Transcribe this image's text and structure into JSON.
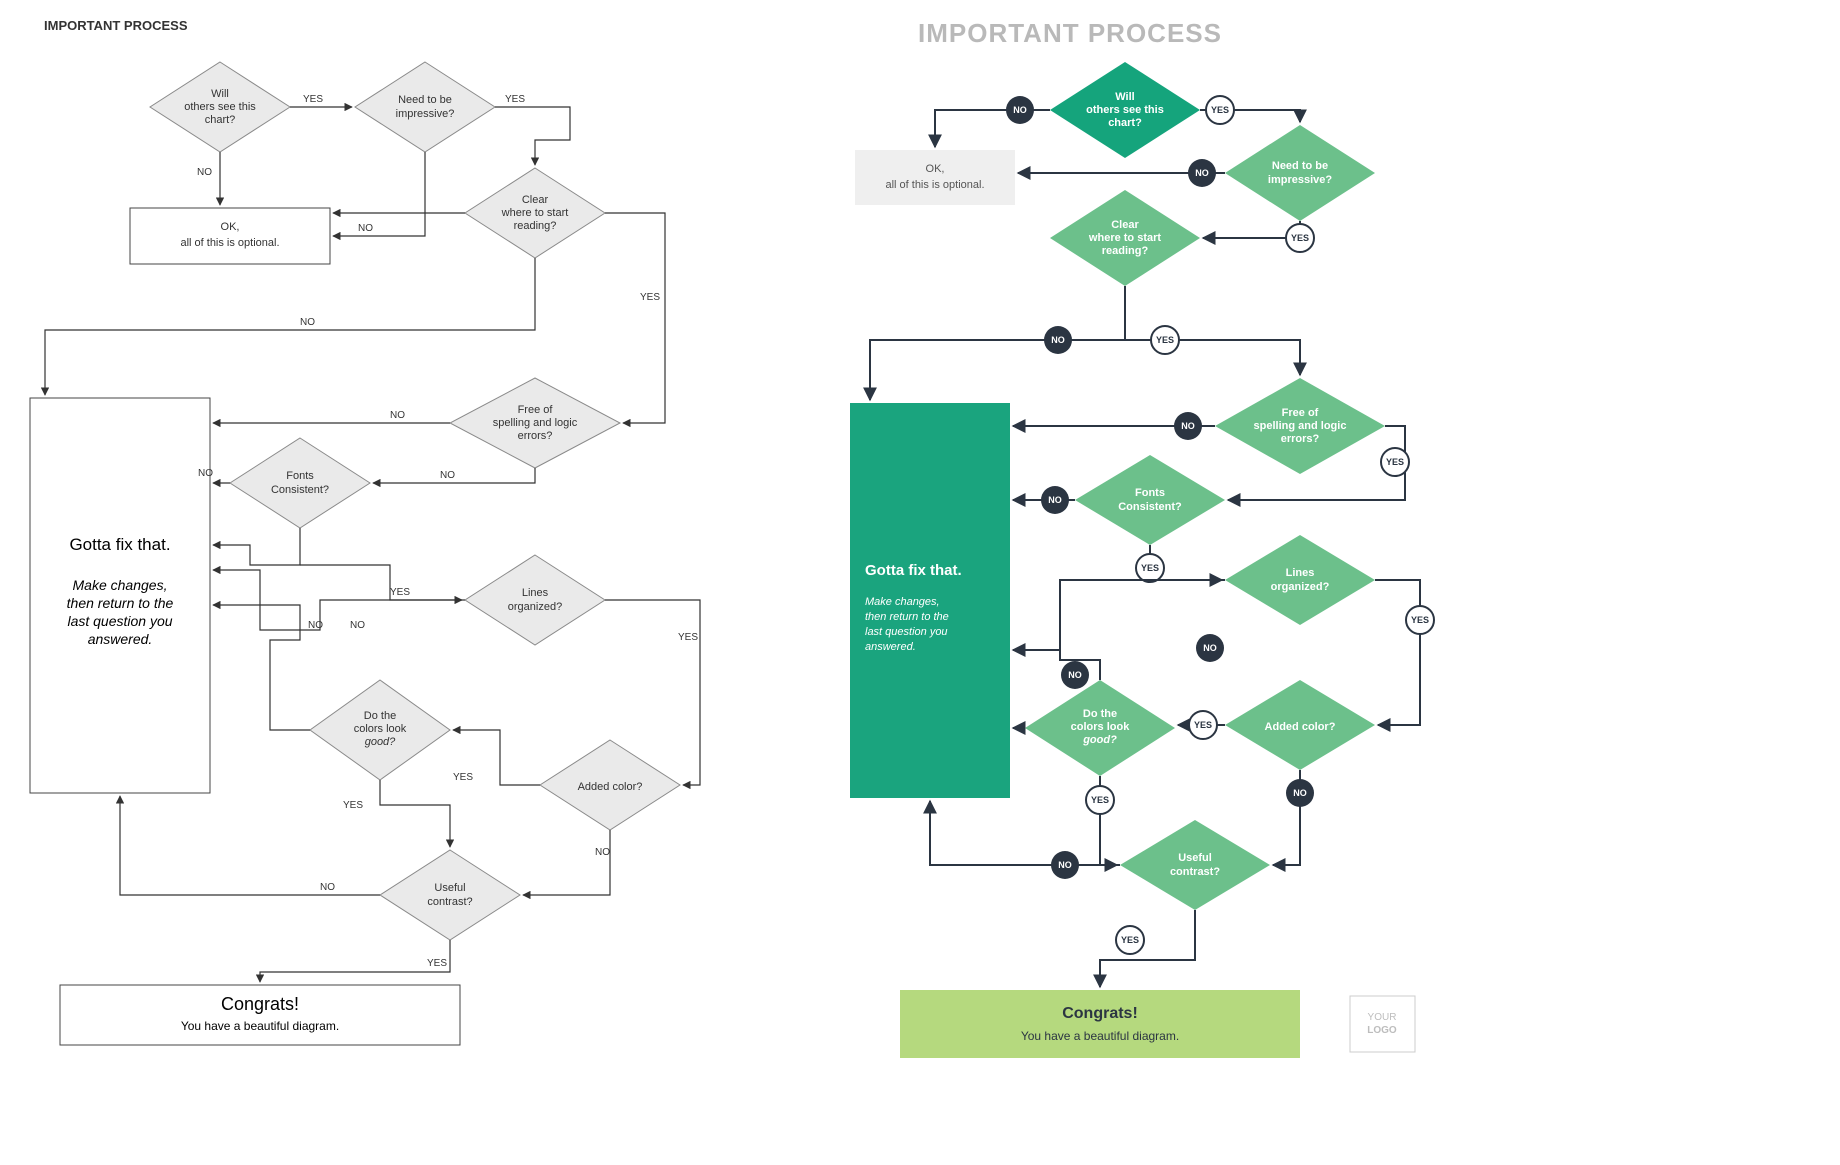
{
  "title": "IMPORTANT PROCESS",
  "yes": "YES",
  "no": "NO",
  "nodes": {
    "q1a": "Will",
    "q1b": "others see this",
    "q1c": "chart?",
    "q2a": "Need to be",
    "q2b": "impressive?",
    "q3a": "Clear",
    "q3b": "where to start",
    "q3c": "reading?",
    "q4a": "Free of",
    "q4b": "spelling and logic",
    "q4c": "errors?",
    "q5a": "Fonts",
    "q5b": "Consistent?",
    "q6a": "Lines",
    "q6b": "organized?",
    "q7a": "Added color?",
    "q8a": "Do the",
    "q8b": "colors look",
    "q8c": "good?",
    "q9a": "Useful",
    "q9b": "contrast?",
    "opt1": "OK,",
    "opt2": "all of this is optional.",
    "fix1": "Gotta fix that.",
    "fix2": "Make changes,",
    "fix3": "then return to the",
    "fix4": "last question you",
    "fix5": "answered.",
    "cong1": "Congrats!",
    "cong2": "You have a beautiful diagram."
  },
  "logo1": "YOUR",
  "logo2": "LOGO",
  "chart_data": {
    "type": "flowchart",
    "nodes": [
      {
        "id": "q1",
        "type": "decision",
        "text": "Will others see this chart?"
      },
      {
        "id": "q2",
        "type": "decision",
        "text": "Need to be impressive?"
      },
      {
        "id": "q3",
        "type": "decision",
        "text": "Clear where to start reading?"
      },
      {
        "id": "q4",
        "type": "decision",
        "text": "Free of spelling and logic errors?"
      },
      {
        "id": "q5",
        "type": "decision",
        "text": "Fonts Consistent?"
      },
      {
        "id": "q6",
        "type": "decision",
        "text": "Lines organized?"
      },
      {
        "id": "q7",
        "type": "decision",
        "text": "Added color?"
      },
      {
        "id": "q8",
        "type": "decision",
        "text": "Do the colors look good?"
      },
      {
        "id": "q9",
        "type": "decision",
        "text": "Useful contrast?"
      },
      {
        "id": "opt",
        "type": "terminal",
        "text": "OK, all of this is optional."
      },
      {
        "id": "fix",
        "type": "process",
        "text": "Gotta fix that. Make changes, then return to the last question you answered."
      },
      {
        "id": "cong",
        "type": "terminal",
        "text": "Congrats! You have a beautiful diagram."
      }
    ],
    "edges": [
      {
        "from": "q1",
        "to": "opt",
        "label": "NO"
      },
      {
        "from": "q1",
        "to": "q2",
        "label": "YES"
      },
      {
        "from": "q2",
        "to": "opt",
        "label": "NO"
      },
      {
        "from": "q2",
        "to": "q3",
        "label": "YES"
      },
      {
        "from": "q3",
        "to": "fix",
        "label": "NO"
      },
      {
        "from": "q3",
        "to": "q4",
        "label": "YES"
      },
      {
        "from": "q4",
        "to": "fix",
        "label": "NO"
      },
      {
        "from": "q4",
        "to": "q5",
        "label": "YES"
      },
      {
        "from": "q5",
        "to": "fix",
        "label": "NO"
      },
      {
        "from": "q5",
        "to": "q6",
        "label": "YES"
      },
      {
        "from": "q6",
        "to": "fix",
        "label": "NO"
      },
      {
        "from": "q6",
        "to": "q7",
        "label": "YES"
      },
      {
        "from": "q7",
        "to": "q9",
        "label": "NO"
      },
      {
        "from": "q7",
        "to": "q8",
        "label": "YES"
      },
      {
        "from": "q8",
        "to": "fix",
        "label": "NO"
      },
      {
        "from": "q8",
        "to": "q9",
        "label": "YES"
      },
      {
        "from": "q9",
        "to": "fix",
        "label": "NO"
      },
      {
        "from": "q9",
        "to": "cong",
        "label": "YES"
      }
    ],
    "variants": [
      "monochrome-uncolored",
      "green-colored"
    ]
  }
}
